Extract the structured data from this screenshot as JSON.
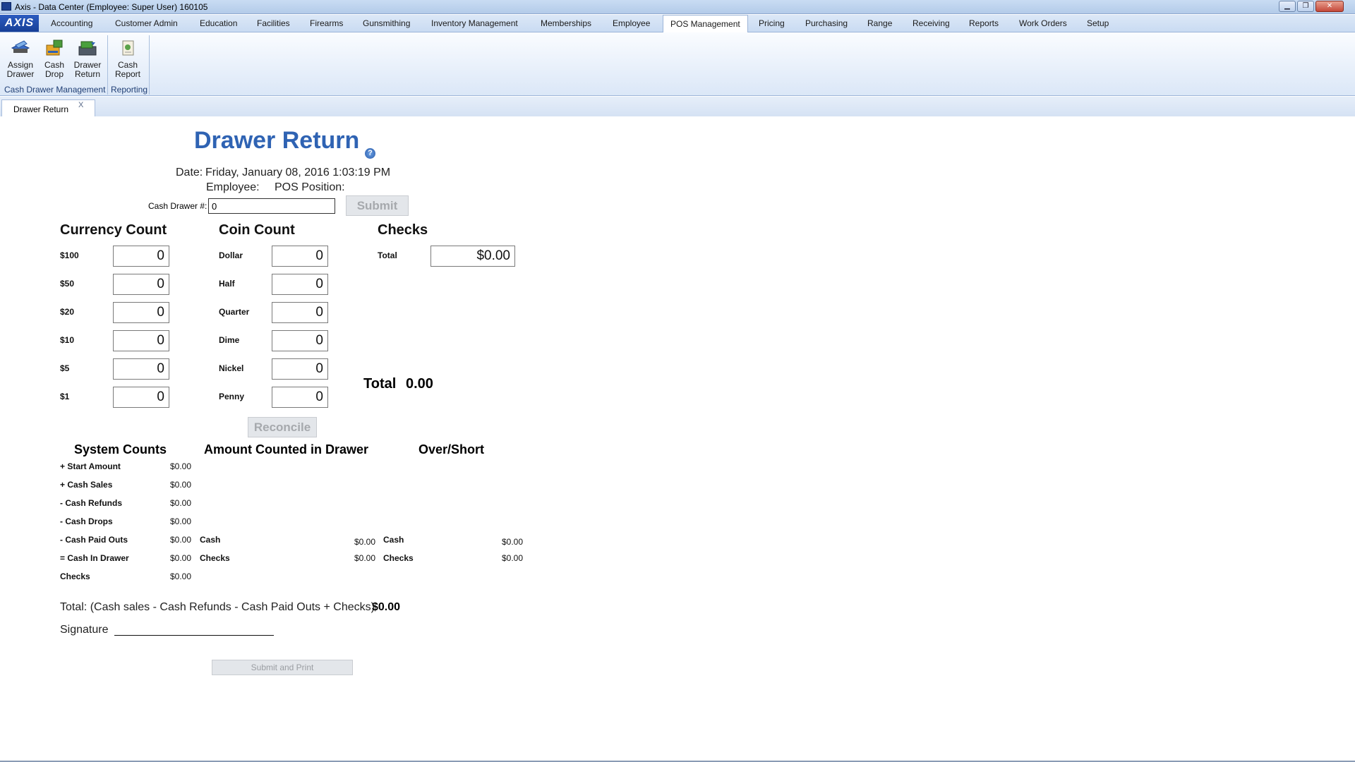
{
  "window": {
    "title": "Axis - Data Center  (Employee: Super User) 160105",
    "controls": {
      "minimize": "▁",
      "maximize": "❐",
      "close": "✕"
    }
  },
  "menu": {
    "logo": "AXIS",
    "items": [
      "Accounting",
      "Customer Admin",
      "Education",
      "Facilities",
      "Firearms",
      "Gunsmithing",
      "Inventory Management",
      "Memberships",
      "Employee",
      "POS Management",
      "Pricing",
      "Purchasing",
      "Range",
      "Receiving",
      "Reports",
      "Work Orders",
      "Setup"
    ],
    "active": "POS Management"
  },
  "ribbon": {
    "buttons": [
      {
        "line1": "Assign",
        "line2": "Drawer",
        "icon": "assign-drawer-icon"
      },
      {
        "line1": "Cash",
        "line2": "Drop",
        "icon": "cash-drop-icon"
      },
      {
        "line1": "Drawer",
        "line2": "Return",
        "icon": "drawer-return-icon"
      },
      {
        "line1": "Cash",
        "line2": "Report",
        "icon": "cash-report-icon"
      }
    ],
    "groups": [
      "Cash Drawer Management",
      "Reporting"
    ]
  },
  "doc_tab": {
    "label": "Drawer Return",
    "close": "X"
  },
  "form": {
    "title": "Drawer Return",
    "help_glyph": "?",
    "date_label": "Date:",
    "date_value": "Friday, January 08, 2016 1:03:19 PM",
    "employee_label": "Employee:",
    "pos_position_label": "POS Position:",
    "cash_drawer_label": "Cash Drawer #:",
    "cash_drawer_value": "0",
    "submit_label": "Submit",
    "currency": {
      "heading": "Currency Count",
      "rows": [
        {
          "label": "$100",
          "value": "0"
        },
        {
          "label": "$50",
          "value": "0"
        },
        {
          "label": "$20",
          "value": "0"
        },
        {
          "label": "$10",
          "value": "0"
        },
        {
          "label": "$5",
          "value": "0"
        },
        {
          "label": "$1",
          "value": "0"
        }
      ]
    },
    "coins": {
      "heading": "Coin Count",
      "rows": [
        {
          "label": "Dollar",
          "value": "0"
        },
        {
          "label": "Half",
          "value": "0"
        },
        {
          "label": "Quarter",
          "value": "0"
        },
        {
          "label": "Dime",
          "value": "0"
        },
        {
          "label": "Nickel",
          "value": "0"
        },
        {
          "label": "Penny",
          "value": "0"
        }
      ]
    },
    "checks": {
      "heading": "Checks",
      "total_label": "Total",
      "total_value": "$0.00"
    },
    "grand_total_label": "Total",
    "grand_total_value": "0.00",
    "reconcile_label": "Reconcile",
    "system_counts": {
      "heading": "System Counts",
      "rows": [
        {
          "label": "+ Start Amount",
          "value": "$0.00"
        },
        {
          "label": "+ Cash Sales",
          "value": "$0.00"
        },
        {
          "label": "- Cash Refunds",
          "value": "$0.00"
        },
        {
          "label": "- Cash Drops",
          "value": "$0.00"
        },
        {
          "label": "- Cash Paid Outs",
          "value": "$0.00"
        },
        {
          "label": "= Cash In Drawer",
          "value": "$0.00"
        },
        {
          "label": "Checks",
          "value": "$0.00"
        }
      ]
    },
    "amount_counted": {
      "heading": "Amount Counted in Drawer",
      "rows": [
        {
          "label": "Cash",
          "value": "$0.00"
        },
        {
          "label": "Checks",
          "value": "$0.00"
        }
      ]
    },
    "over_short": {
      "heading": "Over/Short",
      "rows": [
        {
          "label": "Cash",
          "value": "$0.00"
        },
        {
          "label": "Checks",
          "value": "$0.00"
        }
      ]
    },
    "formula_label": "Total: (Cash sales - Cash Refunds - Cash Paid Outs + Checks)",
    "formula_value": "$0.00",
    "signature_label": "Signature",
    "submit_print_label": "Submit and Print"
  }
}
